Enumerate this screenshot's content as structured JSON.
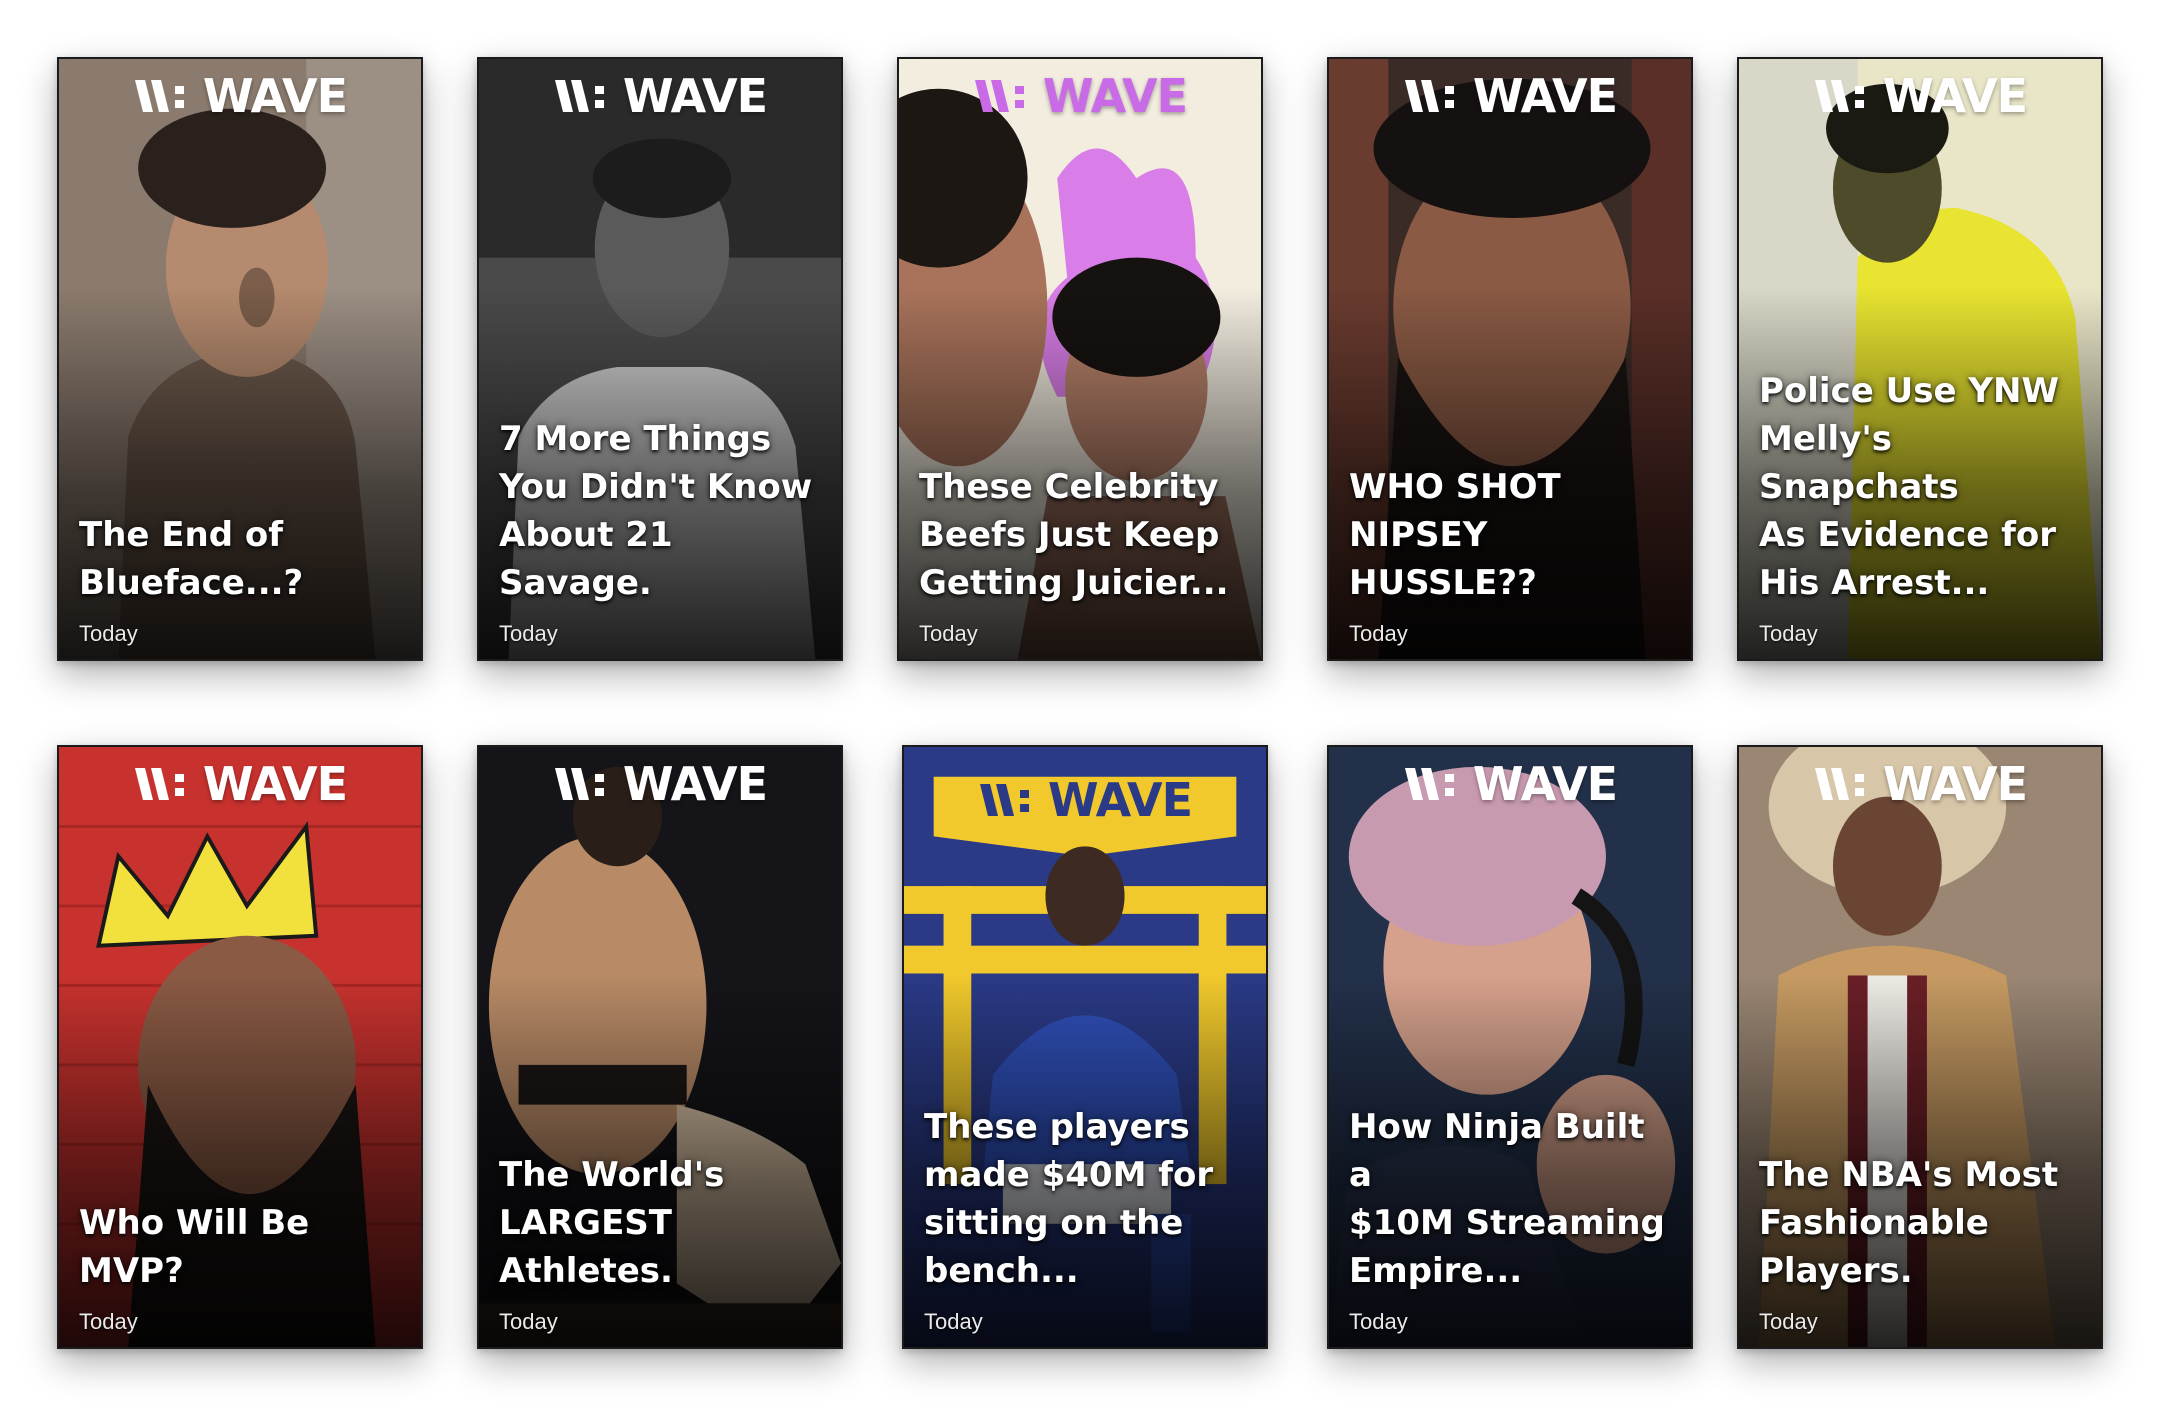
{
  "brand": {
    "name": "WAVE",
    "logo_color": "#ffffff",
    "logo_color_alt": "#c96be6"
  },
  "stories": [
    {
      "headline": "The End of\nBlueface...?",
      "time": "Today",
      "bg": "#7c6d61",
      "accent": "#a8998a"
    },
    {
      "headline": "7 More Things\nYou Didn't Know\nAbout 21 Savage.",
      "time": "Today",
      "bg": "#3b3b3b",
      "accent": "#bdbdbd"
    },
    {
      "headline": "These Celebrity\nBeefs Just Keep\nGetting Juicier...",
      "time": "Today",
      "bg": "#f3ede0",
      "accent": "#d97ee8"
    },
    {
      "headline": "WHO SHOT\nNIPSEY HUSSLE??",
      "time": "Today",
      "bg": "#2c2220",
      "accent": "#8b5a45"
    },
    {
      "headline": "Police Use YNW\nMelly's Snapchats\nAs Evidence for\nHis Arrest...",
      "time": "Today",
      "bg": "#d7d22a",
      "accent": "#f4ef3c"
    },
    {
      "headline": "Who Will Be\nMVP?",
      "time": "Today",
      "bg": "#c8322e",
      "accent": "#f2e13c"
    },
    {
      "headline": "The World's\nLARGEST\nAthletes.",
      "time": "Today",
      "bg": "#141419",
      "accent": "#c49a76"
    },
    {
      "headline": "These players\nmade $40M for\nsitting on the\nbench...",
      "time": "Today",
      "bg": "#2a3a86",
      "accent": "#f1c92c"
    },
    {
      "headline": "How Ninja Built a\n$10M Streaming\nEmpire...",
      "time": "Today",
      "bg": "#26344e",
      "accent": "#d6a18c"
    },
    {
      "headline": "The NBA's Most\nFashionable\nPlayers.",
      "time": "Today",
      "bg": "#8a7561",
      "accent": "#c69a62"
    }
  ]
}
